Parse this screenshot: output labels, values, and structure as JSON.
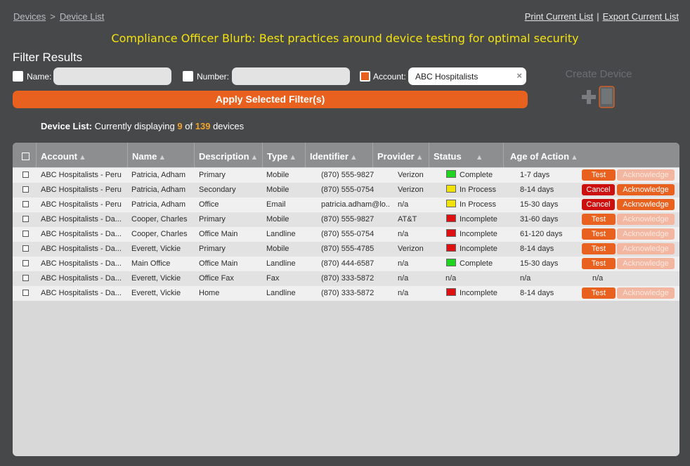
{
  "breadcrumb": {
    "devices": "Devices",
    "separator": ">",
    "device_list": "Device List"
  },
  "top_links": {
    "print": "Print Current List",
    "separator": "|",
    "export": "Export Current List"
  },
  "blurb": "Compliance Officer Blurb: Best practices around device testing for optimal security",
  "filter": {
    "title": "Filter Results",
    "name_label": "Name:",
    "name_value": "",
    "number_label": "Number:",
    "number_value": "",
    "account_label": "Account:",
    "account_value": "ABC Hospitalists",
    "clear_icon": "×",
    "apply_label": "Apply Selected Filter(s)"
  },
  "create_device": {
    "label": "Create Device",
    "icon": "plus-phone-icon"
  },
  "summary": {
    "prefix": "Device List:",
    "text1": "Currently displaying",
    "shown": "9",
    "of": "of",
    "total": "139",
    "suffix": "devices"
  },
  "table": {
    "headers": {
      "account": "Account",
      "name": "Name",
      "description": "Description",
      "type": "Type",
      "identifier": "Identifier",
      "provider": "Provider",
      "status": "Status",
      "age": "Age of Action"
    },
    "sort_arrow": "▲",
    "rows": [
      {
        "account": "ABC Hospitalists - Peru",
        "name": "Patricia, Adham",
        "description": "Primary",
        "type": "Mobile",
        "identifier": "(870) 555-9827",
        "provider": "Verizon",
        "status_color": "#22d422",
        "status": "Complete",
        "age": "1-7 days",
        "test": "Test",
        "ack": "Acknowledge",
        "ack_enabled": false,
        "cancel": ""
      },
      {
        "account": "ABC Hospitalists - Peru",
        "name": "Patricia, Adham",
        "description": "Secondary",
        "type": "Mobile",
        "identifier": "(870) 555-0754",
        "provider": "Verizon",
        "status_color": "#f2e20c",
        "status": "In Process",
        "age": "8-14 days",
        "test": "",
        "ack": "Acknowledge",
        "ack_enabled": true,
        "cancel": "Cancel"
      },
      {
        "account": "ABC Hospitalists - Peru",
        "name": "Patricia, Adham",
        "description": "Office",
        "type": "Email",
        "identifier": "patricia.adham@lo...",
        "provider": "n/a",
        "status_color": "#f2e20c",
        "status": "In Process",
        "age": "15-30 days",
        "test": "",
        "ack": "Acknowledge",
        "ack_enabled": true,
        "cancel": "Cancel"
      },
      {
        "account": "ABC Hospitalists - Da...",
        "name": "Cooper, Charles",
        "description": "Primary",
        "type": "Mobile",
        "identifier": "(870) 555-9827",
        "provider": "AT&T",
        "status_color": "#dd1111",
        "status": "Incomplete",
        "age": "31-60 days",
        "test": "Test",
        "ack": "Acknowledge",
        "ack_enabled": false,
        "cancel": ""
      },
      {
        "account": "ABC Hospitalists - Da...",
        "name": "Cooper, Charles",
        "description": "Office Main",
        "type": "Landline",
        "identifier": "(870) 555-0754",
        "provider": "n/a",
        "status_color": "#dd1111",
        "status": "Incomplete",
        "age": "61-120 days",
        "test": "Test",
        "ack": "Acknowledge",
        "ack_enabled": false,
        "cancel": ""
      },
      {
        "account": "ABC Hospitalists - Da...",
        "name": "Everett, Vickie",
        "description": "Primary",
        "type": "Mobile",
        "identifier": "(870) 555-4785",
        "provider": "Verizon",
        "status_color": "#dd1111",
        "status": "Incomplete",
        "age": "8-14 days",
        "test": "Test",
        "ack": "Acknowledge",
        "ack_enabled": false,
        "cancel": ""
      },
      {
        "account": "ABC Hospitalists - Da...",
        "name": "Main Office",
        "description": "Office Main",
        "type": "Landline",
        "identifier": "(870) 444-6587",
        "provider": "n/a",
        "status_color": "#22d422",
        "status": "Complete",
        "age": "15-30 days",
        "test": "Test",
        "ack": "Acknowledge",
        "ack_enabled": false,
        "cancel": ""
      },
      {
        "account": "ABC Hospitalists - Da...",
        "name": "Everett, Vickie",
        "description": "Office Fax",
        "type": "Fax",
        "identifier": "(870) 333-5872",
        "provider": "n/a",
        "status_color": "",
        "status": "n/a",
        "age": "n/a",
        "test": "",
        "ack": "",
        "ack_enabled": false,
        "cancel": "",
        "action_na": "n/a"
      },
      {
        "account": "ABC Hospitalists - Da...",
        "name": "Everett, Vickie",
        "description": "Home",
        "type": "Landline",
        "identifier": "(870) 333-5872",
        "provider": "n/a",
        "status_color": "#dd1111",
        "status": "Incomplete",
        "age": "8-14 days",
        "test": "Test",
        "ack": "Acknowledge",
        "ack_enabled": false,
        "cancel": ""
      }
    ]
  }
}
